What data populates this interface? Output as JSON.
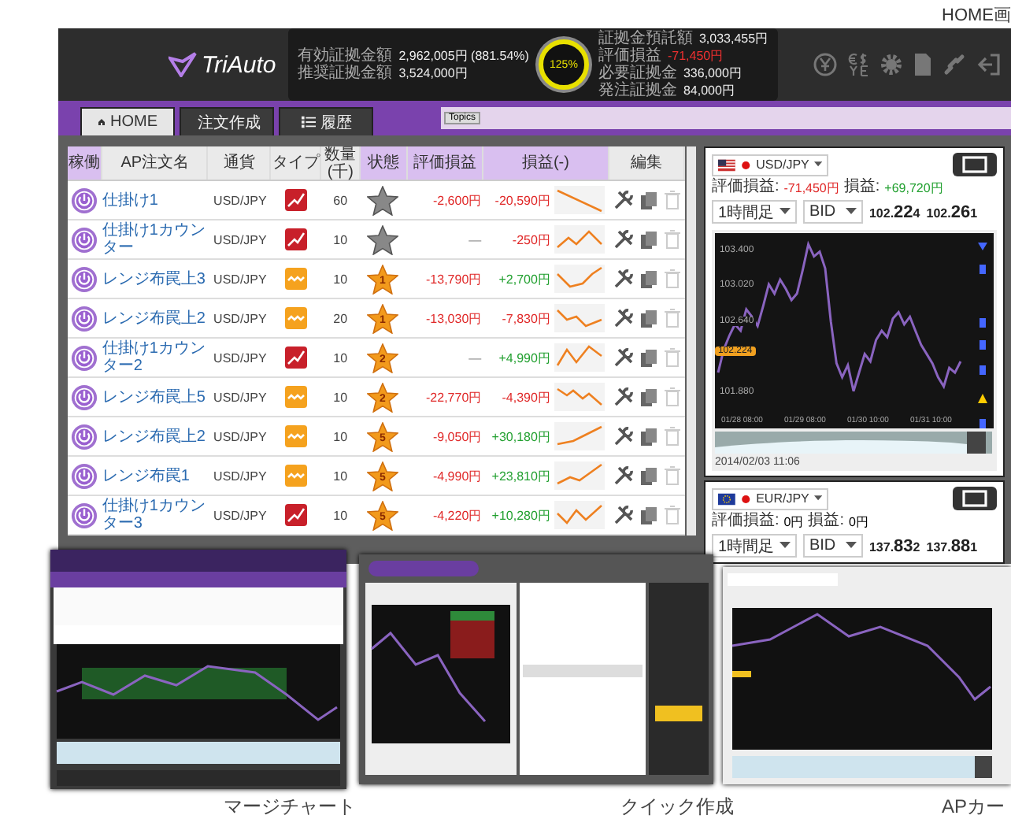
{
  "page_note": "HOME画",
  "app": {
    "logo": "TriAuto"
  },
  "account": {
    "left": [
      {
        "label": "有効証拠金額",
        "value": "2,962,005円 (881.54%)"
      },
      {
        "label": "推奨証拠金額",
        "value": "3,524,000円"
      }
    ],
    "gauge": {
      "reading": "125%"
    },
    "right": [
      {
        "label": "証拠金預託額",
        "value": "3,033,455円",
        "negative": false
      },
      {
        "label": "評価損益",
        "value": "-71,450円",
        "negative": true
      },
      {
        "label": "必要証拠金",
        "value": "336,000円",
        "negative": false
      },
      {
        "label": "発注証拠金",
        "value": "84,000円",
        "negative": false
      }
    ]
  },
  "tabs": [
    {
      "label": "HOME",
      "selected": true
    },
    {
      "label": "注文作成",
      "selected": false
    },
    {
      "label": "履歴",
      "selected": false
    }
  ],
  "topics": {
    "label": "Topics"
  },
  "table": {
    "columns": [
      "稼働",
      "AP注文名",
      "通貨",
      "タイプ",
      "数量(千)",
      "状態",
      "評価損益",
      "損益(-)",
      "編集"
    ],
    "rows": [
      {
        "running": true,
        "name": "仕掛け1",
        "pair": "USD/JPY",
        "kind": "trend",
        "quantity": "60",
        "status_active": false,
        "evaluation": {
          "text": "-2,600円",
          "negative": true
        },
        "pnl": {
          "text": "-20,590円",
          "gain": false
        }
      },
      {
        "running": true,
        "name": "仕掛け1カウンター",
        "pair": "USD/JPY",
        "kind": "trend",
        "quantity": "10",
        "status_active": false,
        "evaluation": {
          "text": "—",
          "negative": false
        },
        "pnl": {
          "text": "-250円",
          "gain": false
        }
      },
      {
        "running": true,
        "name": "レンジ布罠上3",
        "pair": "USD/JPY",
        "kind": "range",
        "quantity": "10",
        "status_active": true,
        "rank": "1",
        "evaluation": {
          "text": "-13,790円",
          "negative": true
        },
        "pnl": {
          "text": "+2,700円",
          "gain": true
        }
      },
      {
        "running": true,
        "name": "レンジ布罠上2",
        "pair": "USD/JPY",
        "kind": "range",
        "quantity": "20",
        "status_active": true,
        "rank": "1",
        "evaluation": {
          "text": "-13,030円",
          "negative": true
        },
        "pnl": {
          "text": "-7,830円",
          "gain": false
        }
      },
      {
        "running": true,
        "name": "仕掛け1カウンター2",
        "pair": "USD/JPY",
        "kind": "trend",
        "quantity": "10",
        "status_active": true,
        "rank": "2",
        "evaluation": {
          "text": "—",
          "negative": false
        },
        "pnl": {
          "text": "+4,990円",
          "gain": true
        }
      },
      {
        "running": true,
        "name": "レンジ布罠上5",
        "pair": "USD/JPY",
        "kind": "range",
        "quantity": "10",
        "status_active": true,
        "rank": "2",
        "evaluation": {
          "text": "-22,770円",
          "negative": true
        },
        "pnl": {
          "text": "-4,390円",
          "gain": false
        }
      },
      {
        "running": true,
        "name": "レンジ布罠上2",
        "pair": "USD/JPY",
        "kind": "range",
        "quantity": "10",
        "status_active": true,
        "rank": "5",
        "evaluation": {
          "text": "-9,050円",
          "negative": true
        },
        "pnl": {
          "text": "+30,180円",
          "gain": true
        }
      },
      {
        "running": true,
        "name": "レンジ布罠1",
        "pair": "USD/JPY",
        "kind": "range",
        "quantity": "10",
        "status_active": true,
        "rank": "5",
        "evaluation": {
          "text": "-4,990円",
          "negative": true
        },
        "pnl": {
          "text": "+23,810円",
          "gain": true
        }
      },
      {
        "running": true,
        "name": "仕掛け1カウンター3",
        "pair": "USD/JPY",
        "kind": "trend",
        "quantity": "10",
        "status_active": true,
        "rank": "5",
        "evaluation": {
          "text": "-4,220円",
          "negative": true
        },
        "pnl": {
          "text": "+10,280円",
          "gain": true
        }
      }
    ]
  },
  "cards": [
    {
      "kind": "us",
      "pair": "USD/JPY",
      "eval_label": "評価損益:",
      "evaluation": {
        "text": "-71,450円",
        "negative": true
      },
      "pnl_label": "損益:",
      "pnl": {
        "text": "+69,720円",
        "gain": true
      },
      "timeframe": "1時間足",
      "side": "BID",
      "bid": {
        "head": "102.",
        "big": "22",
        "tail": "4"
      },
      "ask": {
        "head": "102.",
        "big": "26",
        "tail": "1"
      },
      "chart": {
        "current": "102.224",
        "timestamp": "2014/02/03 11:06",
        "time_labels": [
          "01/28 08:00",
          "01/29 08:00",
          "01/30 10:00",
          "01/31 10:00"
        ],
        "chart_data": {
          "type": "line",
          "ylim": [
            101.5,
            103.6
          ],
          "yticks": [
            {
              "value": 103.4,
              "label": "103.400"
            },
            {
              "value": 103.02,
              "label": "103.020"
            },
            {
              "value": 102.64,
              "label": "102.640"
            },
            {
              "value": 101.88,
              "label": "101.880"
            }
          ],
          "series": [
            {
              "color": "#8a64c0",
              "values": [
                102.1,
                102.35,
                102.5,
                102.62,
                102.55,
                102.78,
                102.7,
                102.6,
                102.82,
                103.05,
                102.95,
                103.1,
                103.0,
                102.88,
                102.95,
                103.2,
                103.48,
                103.35,
                103.4,
                103.22,
                102.65,
                102.2,
                102.05,
                102.18,
                101.9,
                102.1,
                102.3,
                102.22,
                102.45,
                102.55,
                102.48,
                102.68,
                102.75,
                102.62,
                102.7,
                102.55,
                102.4,
                102.3,
                102.2,
                102.05,
                101.95,
                102.15,
                102.1,
                102.22
              ]
            }
          ]
        }
      }
    },
    {
      "kind": "eu",
      "pair": "EUR/JPY",
      "eval_label": "評価損益:",
      "evaluation": {
        "text": "0円",
        "negative": false
      },
      "pnl_label": "損益:",
      "pnl": {
        "text": "0円",
        "gain": false
      },
      "timeframe": "1時間足",
      "side": "BID",
      "bid": {
        "head": "137.",
        "big": "83",
        "tail": "2"
      },
      "ask": {
        "head": "137.",
        "big": "88",
        "tail": "1"
      }
    }
  ],
  "showcase": [
    {
      "kind": "merge_chart",
      "caption": "マージチャート"
    },
    {
      "kind": "quick_order",
      "caption": "クイック作成"
    },
    {
      "kind": "ap_card",
      "caption": "APカー"
    }
  ]
}
